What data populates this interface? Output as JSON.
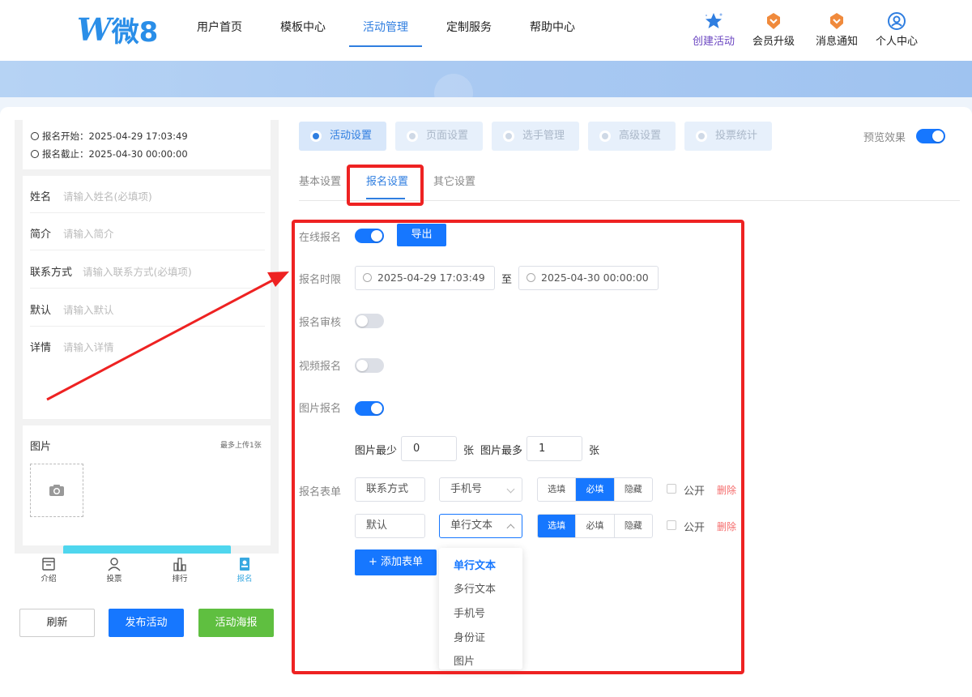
{
  "header": {
    "logo_letter": "W",
    "logo_text": "微8",
    "nav": [
      "用户首页",
      "模板中心",
      "活动管理",
      "定制服务",
      "帮助中心"
    ],
    "active_nav": "活动管理",
    "right_nav": [
      {
        "label": "创建活动",
        "icon": "star-icon"
      },
      {
        "label": "会员升级",
        "icon": "badge-icon"
      },
      {
        "label": "消息通知",
        "icon": "bell-badge-icon"
      },
      {
        "label": "个人中心",
        "icon": "user-circle-icon"
      }
    ]
  },
  "preview": {
    "signup_start": "报名开始：2025-04-29 17:03:49",
    "signup_end": "报名截止：2025-04-30 00:00:00",
    "fields": [
      {
        "label": "姓名",
        "placeholder": "请输入姓名(必填项)"
      },
      {
        "label": "简介",
        "placeholder": "请输入简介"
      },
      {
        "label": "联系方式",
        "placeholder": "请输入联系方式(必填项)"
      },
      {
        "label": "默认",
        "placeholder": "请输入默认"
      },
      {
        "label": "详情",
        "placeholder": "请输入详情"
      }
    ],
    "picture_title": "图片",
    "picture_limit": "最多上传1张",
    "tabbar": [
      {
        "label": "介绍",
        "icon": "intro-icon"
      },
      {
        "label": "投票",
        "icon": "person-icon"
      },
      {
        "label": "排行",
        "icon": "bar-chart-icon"
      },
      {
        "label": "报名",
        "icon": "signup-icon"
      }
    ],
    "buttons": {
      "refresh": "刷新",
      "publish": "发布活动",
      "poster": "活动海报"
    }
  },
  "settings": {
    "main_tabs": [
      "活动设置",
      "页面设置",
      "选手管理",
      "高级设置",
      "投票统计"
    ],
    "preview_effect": "预览效果",
    "preview_effect_on": true,
    "sub_tabs": [
      "基本设置",
      "报名设置",
      "其它设置"
    ],
    "active_sub_tab": "报名设置",
    "online_signup": {
      "label": "在线报名",
      "on": true,
      "export_label": "导出"
    },
    "time_limit": {
      "label": "报名时限",
      "start": "2025-04-29 17:03:49",
      "to": "至",
      "end": "2025-04-30 00:00:00"
    },
    "review": {
      "label": "报名审核",
      "on": false
    },
    "video": {
      "label": "视频报名",
      "on": false
    },
    "picture": {
      "label": "图片报名",
      "on": true
    },
    "picture_count": {
      "min_label": "图片最少",
      "min": "0",
      "unit": "张",
      "max_label": "图片最多",
      "max": "1"
    },
    "form": {
      "label": "报名表单",
      "rows": [
        {
          "name": "联系方式",
          "type": "手机号",
          "mode": "必填",
          "public_label": "公开",
          "delete_label": "删除"
        },
        {
          "name": "默认",
          "type": "单行文本",
          "mode": "选填",
          "public_label": "公开",
          "delete_label": "删除"
        }
      ],
      "modes": [
        "选填",
        "必填",
        "隐藏"
      ],
      "add_label": "+ 添加表单",
      "type_options": [
        "单行文本",
        "多行文本",
        "手机号",
        "身份证",
        "图片"
      ],
      "selected_option": "单行文本"
    }
  },
  "colors": {
    "primary": "#1677ff",
    "nav_active": "#2f7ee0",
    "annotation_red": "#ee2222",
    "green": "#5fbf40",
    "danger": "#f56c6c"
  }
}
